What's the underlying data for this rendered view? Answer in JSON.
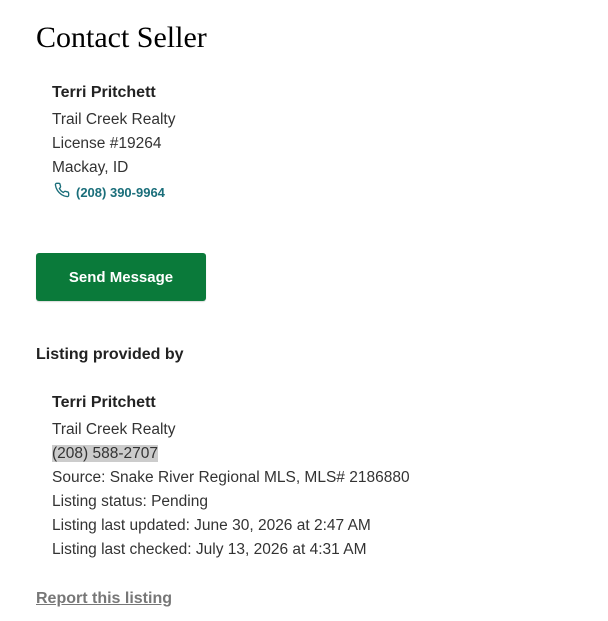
{
  "page_title": "Contact Seller",
  "seller": {
    "name": "Terri Pritchett",
    "company": "Trail Creek Realty",
    "license": "License #19264",
    "location": "Mackay, ID",
    "phone": "(208) 390-9964",
    "phone_icon": "phone-icon"
  },
  "send_button_label": "Send Message",
  "listing_provider": {
    "heading": "Listing provided by",
    "name": "Terri Pritchett",
    "company": "Trail Creek Realty",
    "phone": "(208) 588-2707",
    "source": "Source: Snake River Regional MLS, MLS# 2186880",
    "status": "Listing status: Pending",
    "last_updated": "Listing last updated: June 30, 2026 at 2:47 AM",
    "last_checked": "Listing last checked: July 13, 2026 at 4:31 AM"
  },
  "report_link_label": "Report this listing",
  "colors": {
    "accent_green": "#0a7a3a",
    "phone_link": "#1a6e7a",
    "highlight": "#cccccc"
  }
}
